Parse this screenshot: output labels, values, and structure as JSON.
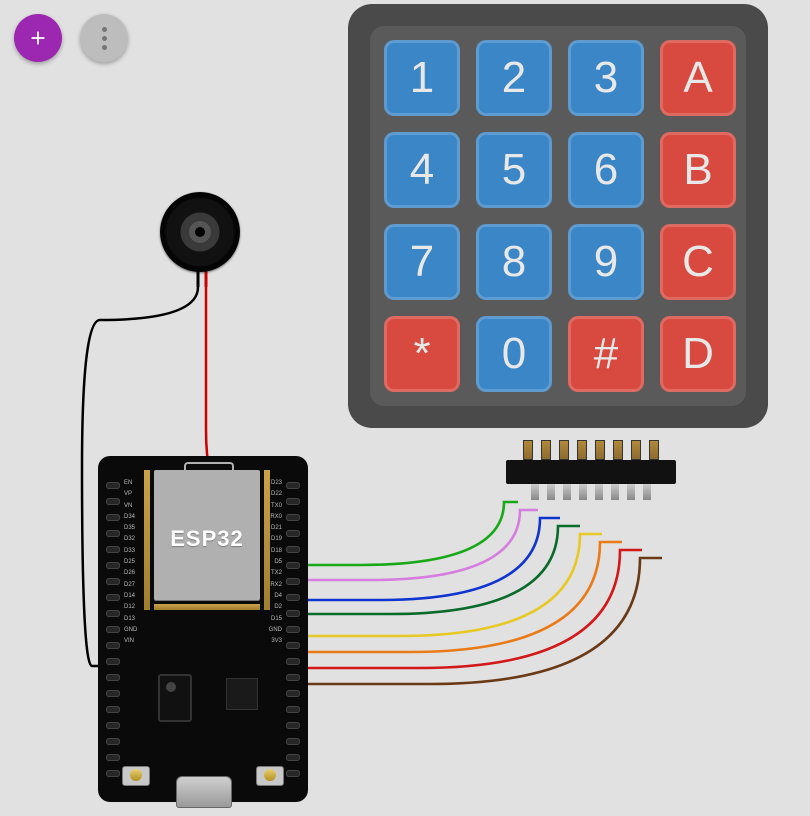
{
  "toolbar": {
    "add_label": "+",
    "more_label": "⋮"
  },
  "keypad": {
    "keys": [
      {
        "label": "1",
        "color": "blue"
      },
      {
        "label": "2",
        "color": "blue"
      },
      {
        "label": "3",
        "color": "blue"
      },
      {
        "label": "A",
        "color": "red"
      },
      {
        "label": "4",
        "color": "blue"
      },
      {
        "label": "5",
        "color": "blue"
      },
      {
        "label": "6",
        "color": "blue"
      },
      {
        "label": "B",
        "color": "red"
      },
      {
        "label": "7",
        "color": "blue"
      },
      {
        "label": "8",
        "color": "blue"
      },
      {
        "label": "9",
        "color": "blue"
      },
      {
        "label": "C",
        "color": "red"
      },
      {
        "label": "*",
        "color": "red"
      },
      {
        "label": "0",
        "color": "blue"
      },
      {
        "label": "#",
        "color": "red"
      },
      {
        "label": "D",
        "color": "red"
      }
    ]
  },
  "board": {
    "mcu_label": "ESP32",
    "left_pins": [
      "EN",
      "VP",
      "VN",
      "D34",
      "D35",
      "D32",
      "D33",
      "D25",
      "D26",
      "D27",
      "D14",
      "D12",
      "D13",
      "GND",
      "VIN"
    ],
    "right_pins": [
      "D23",
      "D22",
      "TX0",
      "RX0",
      "D21",
      "D19",
      "D18",
      "D5",
      "TX2",
      "RX2",
      "D4",
      "D2",
      "D15",
      "GND",
      "3V3"
    ]
  },
  "wires": [
    {
      "from": "buzzer-",
      "to": "GND",
      "color": "#000000"
    },
    {
      "from": "buzzer+",
      "to": "D21",
      "color": "#cc0000"
    },
    {
      "from": "D19",
      "to": "keypad.R1",
      "color": "#18a818"
    },
    {
      "from": "D18",
      "to": "keypad.R2",
      "color": "#d67de0"
    },
    {
      "from": "D5",
      "to": "keypad.R3",
      "color": "#1034d0"
    },
    {
      "from": "TX2",
      "to": "keypad.R4",
      "color": "#0a6a2a"
    },
    {
      "from": "RX2",
      "to": "keypad.C1",
      "color": "#e8c824"
    },
    {
      "from": "D4",
      "to": "keypad.C2",
      "color": "#ea7a18"
    },
    {
      "from": "D2",
      "to": "keypad.C3",
      "color": "#d21818"
    },
    {
      "from": "D15",
      "to": "keypad.C4",
      "color": "#6a3a16"
    }
  ],
  "colors": {
    "key_blue": "#3b86c6",
    "key_red": "#d84a3f",
    "keypad_body": "#4a4a4a",
    "accent": "#9c27b0"
  }
}
